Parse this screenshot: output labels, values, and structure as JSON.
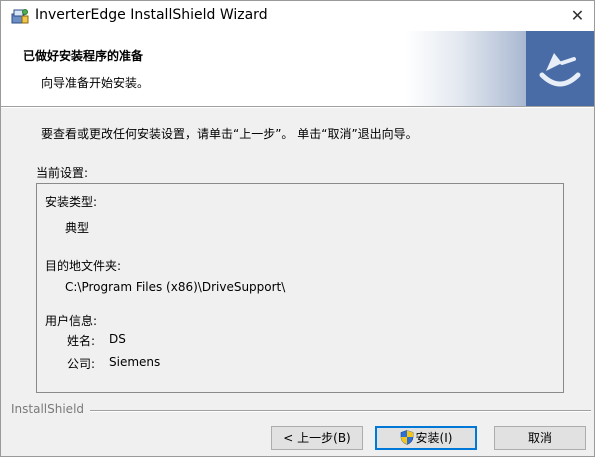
{
  "window": {
    "title": "InverterEdge InstallShield Wizard",
    "close_glyph": "✕"
  },
  "header": {
    "title": "已做好安装程序的准备",
    "subtitle": "向导准备开始安装。"
  },
  "instruction": "要查看或更改任何安装设置，请单击“上一步”。 单击“取消”退出向导。",
  "current_settings": {
    "label": "当前设置:",
    "setup_type_label": "安装类型:",
    "setup_type_value": "典型",
    "destination_label": "目的地文件夹:",
    "destination_value": "C:\\Program Files (x86)\\DriveSupport\\",
    "user_info_label": "用户信息:",
    "name_label": "姓名:",
    "name_value": "DS",
    "company_label": "公司:",
    "company_value": "Siemens"
  },
  "footer": {
    "brand": "InstallShield"
  },
  "buttons": {
    "back": "< 上一步(B)",
    "install": "安装(I)",
    "cancel": "取消"
  },
  "icons": {
    "app": "installer-package-icon",
    "banner": "installshield-logo-icon",
    "install_shield": "uac-shield-icon"
  },
  "colors": {
    "banner_blue": "#4a6ca6",
    "focus_border": "#0078d7"
  }
}
